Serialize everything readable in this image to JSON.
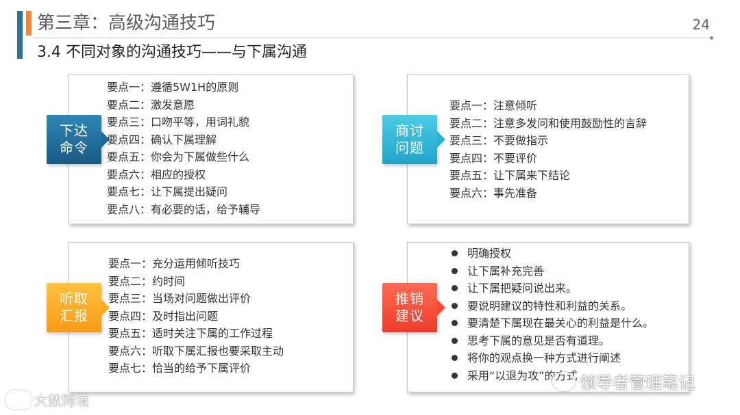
{
  "header": {
    "chapter_title": "第三章：高级沟通技巧",
    "page_number": "24",
    "section_title": "3.4 不同对象的沟通技巧——与下属沟通"
  },
  "panels": {
    "command": {
      "tag": "下达\n命令",
      "items": [
        "要点一：遵循5W1H的原则",
        "要点二：激发意愿",
        "要点三：口吻平等，用词礼貌",
        "要点四：确认下属理解",
        "要点五：你会为下属做些什么",
        "要点六：相应的授权",
        "要点七：让下属提出疑问",
        "要点八：有必要的话，给予辅导"
      ]
    },
    "discuss": {
      "tag": "商讨\n问题",
      "items": [
        "要点一：注意倾听",
        "要点二：注意多发问和使用鼓励性的言辞",
        "要点三：不要做指示",
        "要点四：不要评价",
        "要点五：让下属来下结论",
        "要点六：事先准备"
      ]
    },
    "report": {
      "tag": "听取\n汇报",
      "items": [
        "要点一：充分运用倾听技巧",
        "要点二：约时间",
        "要点三：当场对问题做出评价",
        "要点四：及时指出问题",
        "要点五：适时关注下属的工作过程",
        "要点六：听取下属汇报也要采取主动",
        "要点七：恰当的给予下属评价"
      ]
    },
    "suggest": {
      "tag": "推销\n建议",
      "items": [
        "明确授权",
        "让下属补充完善",
        "让下属把疑问说出来。",
        "要说明建议的特性和利益的关系。",
        "要清楚下属现在最关心的利益是什么。",
        "思考下属的意见是否有道理。",
        "将你的观点换一种方式进行阐述",
        "采用“以退为攻”的方式"
      ]
    }
  },
  "watermarks": {
    "left": "大数跨境",
    "right": "领导者管理笔记"
  },
  "colors": {
    "navy": "#1a5a86",
    "cyan": "#1fa4c9",
    "orange": "#f99a17",
    "red": "#ee3c2a",
    "accent_blue": "#2f6e9c",
    "accent_orange": "#f0883e"
  }
}
